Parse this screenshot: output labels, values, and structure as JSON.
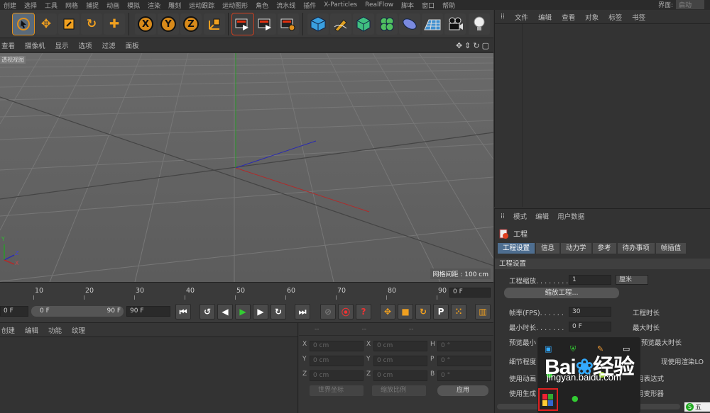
{
  "menubar": {
    "items": [
      "创建",
      "选择",
      "工具",
      "网格",
      "捕捉",
      "动画",
      "模拟",
      "渲染",
      "雕刻",
      "运动跟踪",
      "运动图形",
      "角色",
      "流水线",
      "插件",
      "X-Particles",
      "RealFlow",
      "脚本",
      "窗口",
      "帮助"
    ],
    "layout_label": "界面:",
    "layout_value": "启动"
  },
  "toolbar": {
    "icons": [
      "live-select-icon",
      "move-icon",
      "scale-icon",
      "rotate-icon",
      "last-tool-icon",
      "x-axis-icon",
      "y-axis-icon",
      "z-axis-icon",
      "coordinate-system-icon",
      "render-view-icon",
      "render-picture-viewer-icon",
      "render-settings-icon",
      "cube-icon",
      "pen-icon",
      "subdivision-icon",
      "cloner-icon",
      "deformer-icon",
      "floor-icon",
      "camera-icon",
      "light-icon"
    ],
    "x_label": "X",
    "y_label": "Y",
    "z_label": "Z"
  },
  "viewport": {
    "menu": [
      "查看",
      "摄像机",
      "显示",
      "选项",
      "过滤",
      "面板"
    ],
    "tag": "透视视图",
    "grid_info": "网格间距 : 100 cm",
    "axis_x": "X",
    "axis_y": "Y",
    "axis_z": "Z"
  },
  "timeline": {
    "ticks": [
      "10",
      "20",
      "30",
      "40",
      "50",
      "60",
      "70",
      "80",
      "90"
    ],
    "current_frame": "0 F"
  },
  "playbar": {
    "start_frame": "0 F",
    "preview_min": "0 F",
    "preview_max": "90 F",
    "end_frame": "90 F"
  },
  "material_panel": {
    "menu": [
      "创建",
      "编辑",
      "功能",
      "纹理"
    ]
  },
  "coord_panel": {
    "headers": [
      "--",
      "--",
      "--"
    ],
    "rows": [
      {
        "a_label": "X",
        "a_value": "0 cm",
        "b_label": "X",
        "b_value": "0 cm",
        "c_label": "H",
        "c_value": "0 °"
      },
      {
        "a_label": "Y",
        "a_value": "0 cm",
        "b_label": "Y",
        "b_value": "0 cm",
        "c_label": "P",
        "c_value": "0 °"
      },
      {
        "a_label": "Z",
        "a_value": "0 cm",
        "b_label": "Z",
        "b_value": "0 cm",
        "c_label": "B",
        "c_value": "0 °"
      }
    ],
    "coord_mode": "世界坐标",
    "scale_mode": "缩放比例",
    "apply_label": "应用"
  },
  "object_manager": {
    "menu": [
      "文件",
      "编辑",
      "查看",
      "对象",
      "标签",
      "书签"
    ]
  },
  "attributes": {
    "menu": [
      "模式",
      "编辑",
      "用户数据"
    ],
    "object_name": "工程",
    "tabs": [
      "工程设置",
      "信息",
      "动力学",
      "参考",
      "待办事项",
      "帧插值"
    ],
    "active_tab": "工程设置",
    "section_title": "工程设置",
    "scale_label": "工程缩放. . . . . . . .",
    "scale_value": "1",
    "scale_unit": "厘米",
    "scale_button": "缩放工程...",
    "fps_label": "帧率(FPS). . . . . .",
    "fps_value": "30",
    "min_time_label": "最小时长. . . . . . .",
    "min_time_value": "0 F",
    "preview_min_label": "预览最小",
    "detail_label": "细节程度",
    "use_anim_label": "使用动画",
    "use_gen_label": "使用生成",
    "project_time_label": "工程时长",
    "max_time_label": "最大时长",
    "preview_max_label": "预览最大时长",
    "render_lod_label": "现使用渲染LO",
    "expression_label": "用表达式",
    "deformer_label": "用变形器"
  },
  "watermark": {
    "brand": "Bai",
    "brand_tail": "经验",
    "url": "jingyan.baidu.com"
  },
  "ime": {
    "label": "五"
  }
}
